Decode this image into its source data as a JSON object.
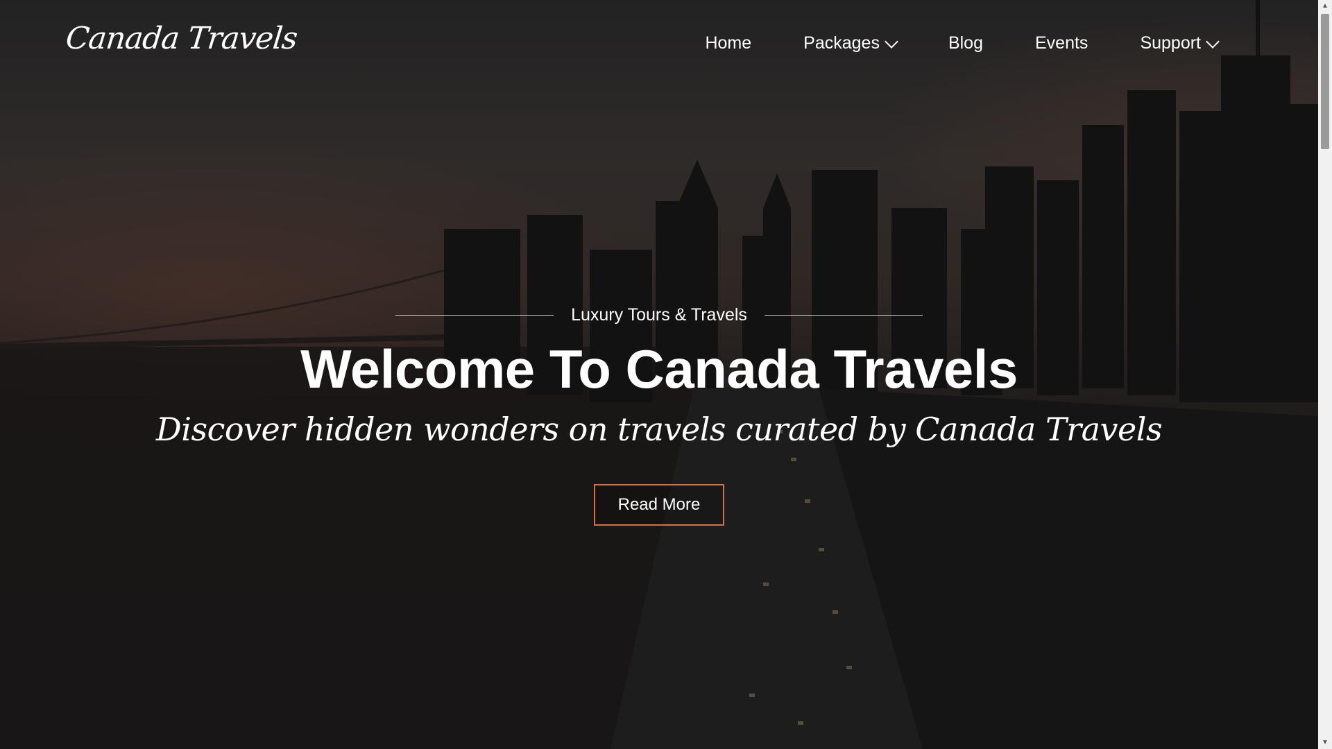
{
  "brand": {
    "logo_text": "Canada Travels"
  },
  "nav": {
    "items": [
      {
        "label": "Home",
        "dropdown": false
      },
      {
        "label": "Packages",
        "dropdown": true
      },
      {
        "label": "Blog",
        "dropdown": false
      },
      {
        "label": "Events",
        "dropdown": false
      },
      {
        "label": "Support",
        "dropdown": true
      }
    ]
  },
  "hero": {
    "kicker": "Luxury Tours & Travels",
    "title": "Welcome To Canada Travels",
    "tagline": "Discover hidden wonders on travels curated by Canada Travels",
    "button_label": "Read More"
  },
  "colors": {
    "button_border": "#d2714a",
    "text": "#ffffff"
  },
  "icons": {
    "dropdown": "chevron-down-icon",
    "scroll_up": "scroll-up-arrow-icon",
    "scroll_down": "scroll-down-arrow-icon"
  }
}
